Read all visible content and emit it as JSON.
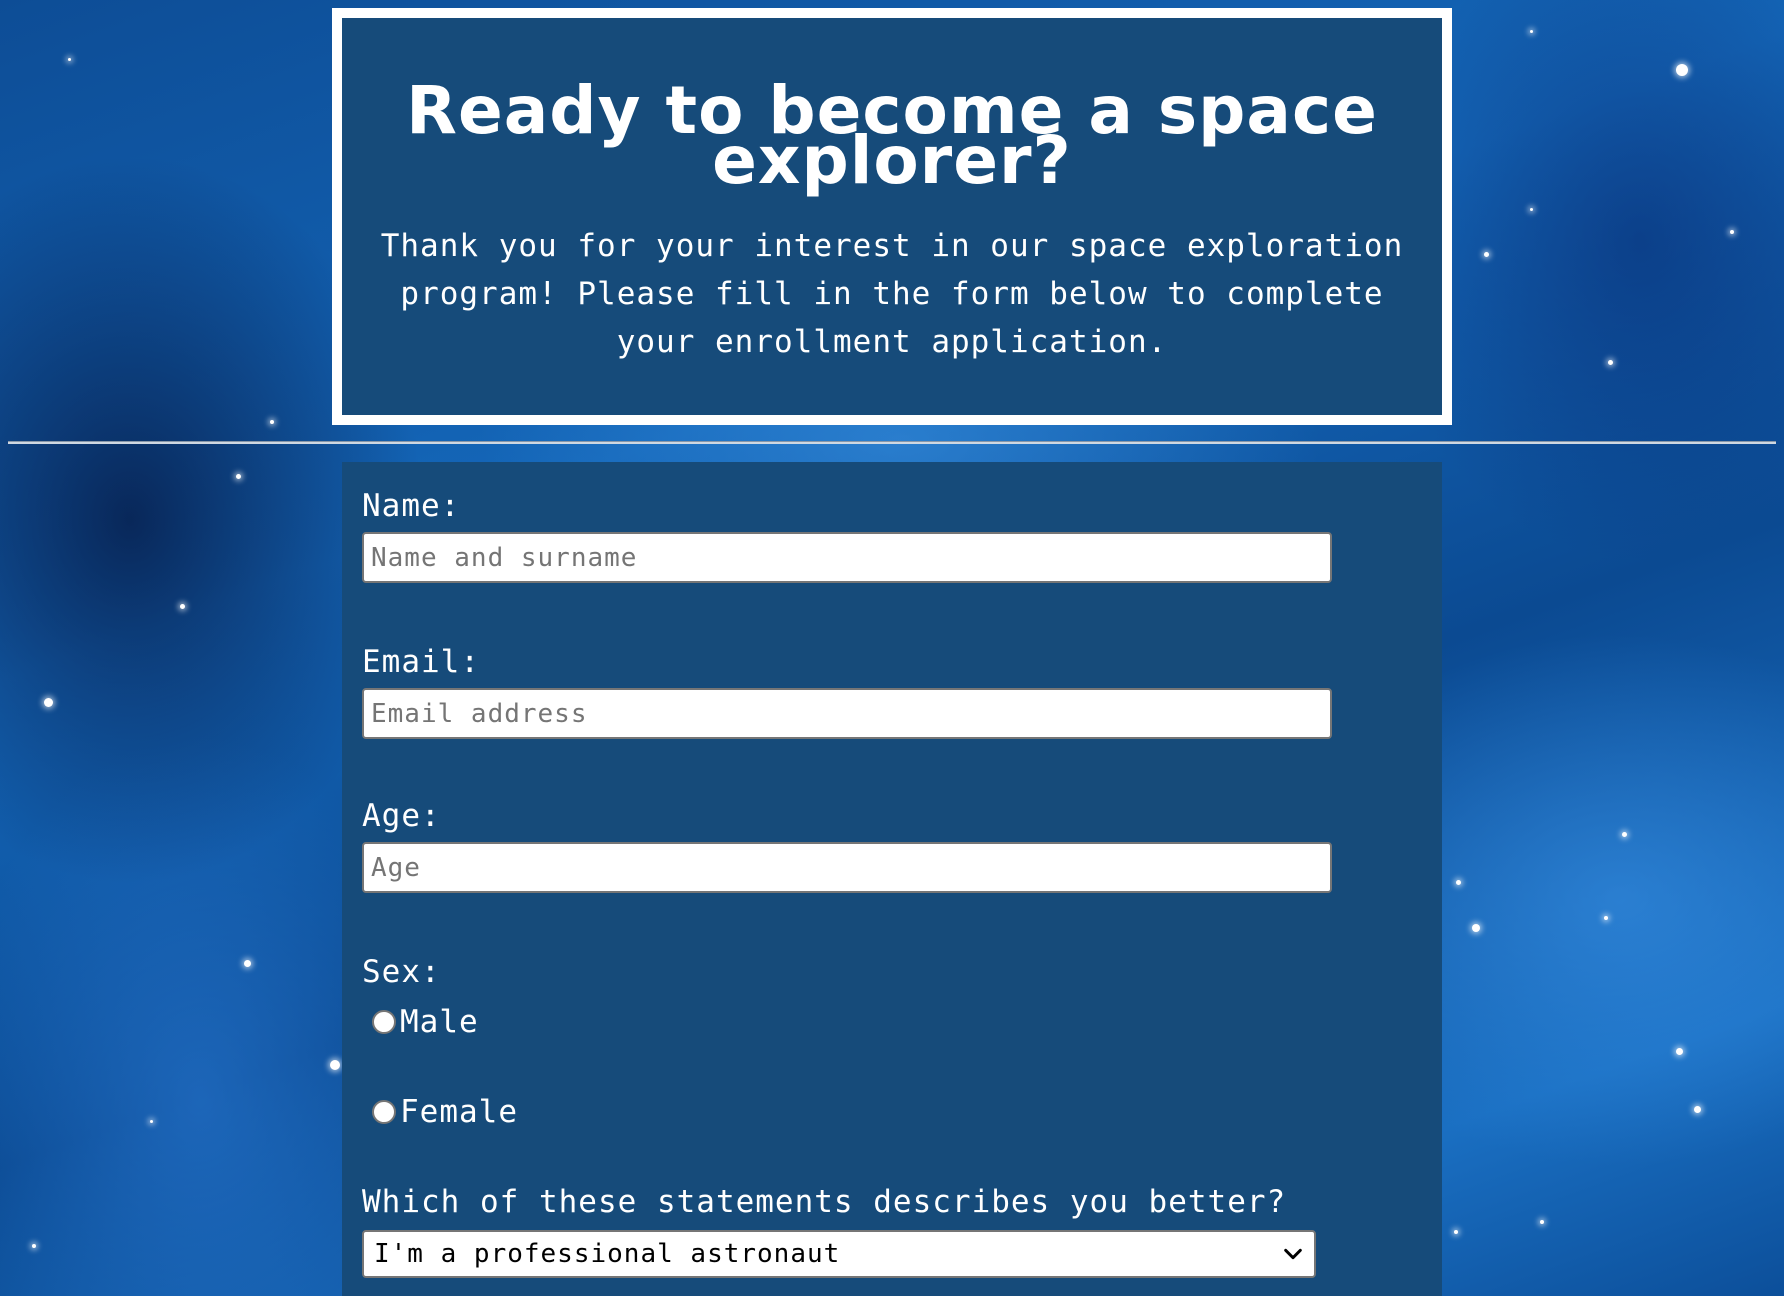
{
  "hero": {
    "title": "Ready to become a space explorer?",
    "description": "Thank you for your interest in our space exploration program! Please fill in the form below to complete your enrollment application."
  },
  "form": {
    "name_label": "Name:",
    "name_placeholder": "Name and surname",
    "email_label": "Email:",
    "email_placeholder": "Email address",
    "age_label": "Age:",
    "age_placeholder": "Age",
    "sex_label": "Sex:",
    "sex_options": [
      "Male",
      "Female"
    ],
    "statement_label": "Which of these statements describes you better?",
    "statement_selected": "I'm a professional astronaut"
  },
  "colors": {
    "panel": "#164b7a",
    "border": "#ffffff",
    "background": "#1466b8"
  },
  "icons": [
    "chevron-down-icon"
  ]
}
